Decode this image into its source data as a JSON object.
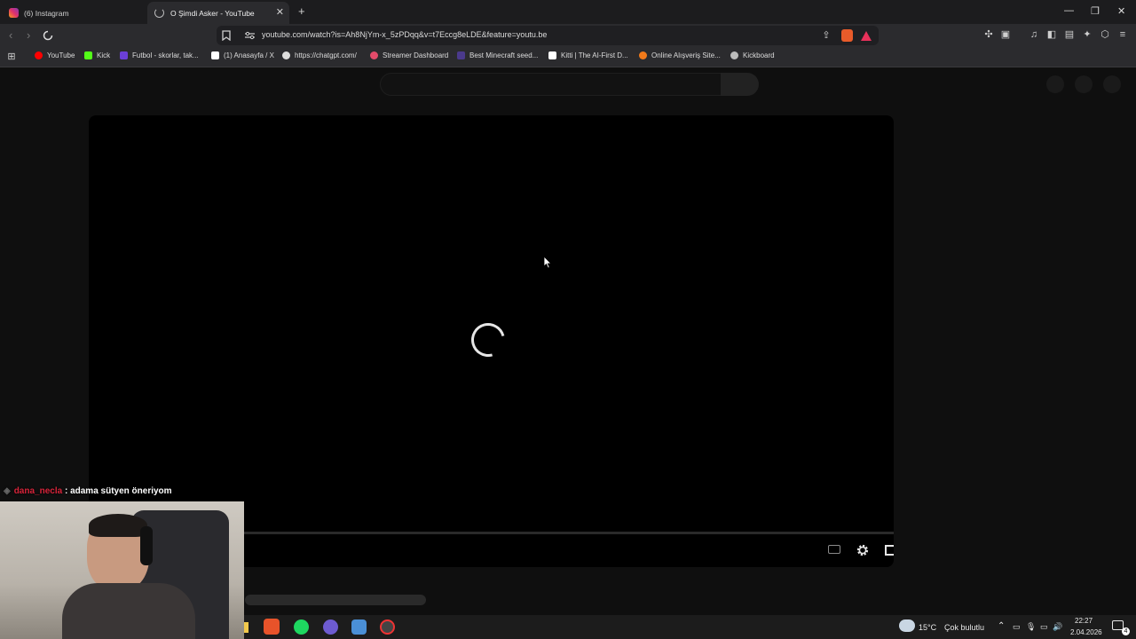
{
  "browser": {
    "tabs": [
      {
        "title": "(6) Instagram",
        "active": false,
        "icon": "instagram-icon"
      },
      {
        "title": "O Şimdi Asker - YouTube",
        "active": true,
        "icon": "loading-spinner-icon"
      }
    ],
    "url": "youtube.com/watch?is=Ah8NjYm-x_5zPDqq&v=t7Eccg8eLDE&feature=youtu.be",
    "bookmarks": [
      {
        "label": "YouTube",
        "icon": "youtube-icon",
        "color": "#ff0000"
      },
      {
        "label": "Kick",
        "icon": "kick-icon",
        "color": "#53fc18"
      },
      {
        "label": "Futbol - skorlar, tak...",
        "icon": "flashscore-icon",
        "color": "#6b3fd6"
      },
      {
        "label": "(1) Anasayfa / X",
        "icon": "x-icon",
        "color": "#ffffff"
      },
      {
        "label": "https://chatgpt.com/",
        "icon": "chatgpt-icon",
        "color": "#dddddd"
      },
      {
        "label": "Streamer Dashboard",
        "icon": "streamer-dashboard-icon",
        "color": "#e34b6a"
      },
      {
        "label": "Best Minecraft seed...",
        "icon": "minecraft-seed-icon",
        "color": "#4b3a8c"
      },
      {
        "label": "Kitti | The AI-First D...",
        "icon": "kitti-icon",
        "color": "#ffffff"
      },
      {
        "label": "Online Alışveriş Site...",
        "icon": "shopping-icon",
        "color": "#f27a1a"
      },
      {
        "label": "Kickboard",
        "icon": "kickboard-icon",
        "color": "#bbbbbb"
      }
    ]
  },
  "stream_overlay": {
    "chat_user": "dana_necla",
    "chat_message": " : adama sütyen öneriyom"
  },
  "taskbar": {
    "weather_temp": "15°C",
    "weather_desc": "Çok bulutlu",
    "time": "22:27",
    "date": "2.04.2026",
    "notification_count": "4"
  },
  "colors": {
    "accent": "#ff0000",
    "chat_user": "#d8243a"
  }
}
